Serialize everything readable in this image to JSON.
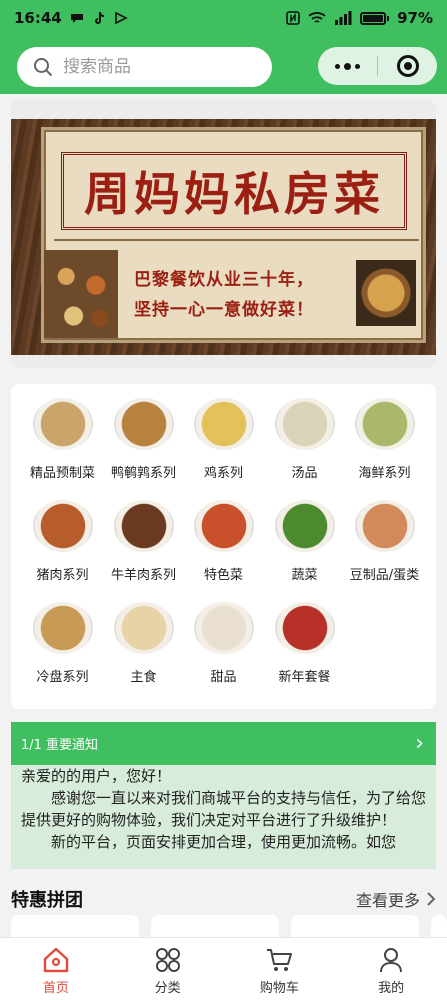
{
  "status_bar": {
    "time": "16:44",
    "battery": "97%"
  },
  "header": {
    "search_placeholder": "搜索商品"
  },
  "banner": {
    "title": "周妈妈私房菜",
    "slogan_line1": "巴黎餐饮从业三十年，",
    "slogan_line2": "坚持一心一意做好菜！"
  },
  "categories": [
    {
      "label": "精品预制菜",
      "color": "#c9a46b"
    },
    {
      "label": "鸭鹌鹑系列",
      "color": "#b9823f"
    },
    {
      "label": "鸡系列",
      "color": "#e3c25a"
    },
    {
      "label": "汤品",
      "color": "#d9d4b8"
    },
    {
      "label": "海鲜系列",
      "color": "#a9b86a"
    },
    {
      "label": "猪肉系列",
      "color": "#b75c2b"
    },
    {
      "label": "牛羊肉系列",
      "color": "#6b3a20"
    },
    {
      "label": "特色菜",
      "color": "#c8502a"
    },
    {
      "label": "蔬菜",
      "color": "#4c8a2f"
    },
    {
      "label": "豆制品/蛋类",
      "color": "#d28a5a"
    },
    {
      "label": "冷盘系列",
      "color": "#c79a55"
    },
    {
      "label": "主食",
      "color": "#e8d3a9"
    },
    {
      "label": "甜品",
      "color": "#e9e0cf"
    },
    {
      "label": "新年套餐",
      "color": "#b8302a"
    }
  ],
  "notice": {
    "header": "1/1 重要通知",
    "greeting": "亲爱的的用户，您好！",
    "para1": "感谢您一直以来对我们商城平台的支持与信任，为了给您提供更好的购物体验，我们决定对平台进行了升级维护！",
    "para2": "新的平台，页面安排更加合理，使用更加流畅。如您"
  },
  "group_buy": {
    "title": "特惠拼团",
    "more": "查看更多"
  },
  "tabs": [
    {
      "label": "首页",
      "icon": "home-icon",
      "active": true
    },
    {
      "label": "分类",
      "icon": "grid-icon",
      "active": false
    },
    {
      "label": "购物车",
      "icon": "cart-icon",
      "active": false
    },
    {
      "label": "我的",
      "icon": "user-icon",
      "active": false
    }
  ],
  "colors": {
    "brand_green": "#3fbf5f",
    "active_tab": "#e04b3a",
    "banner_red": "#9b1f13"
  }
}
